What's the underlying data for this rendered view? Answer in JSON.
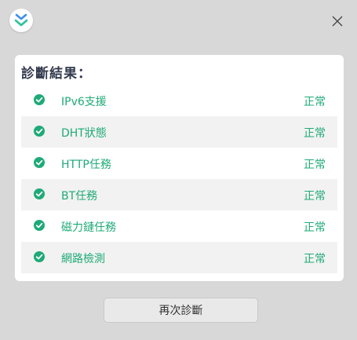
{
  "window": {
    "logo_icon": "app-logo-icon",
    "close_icon": "close-icon"
  },
  "panel": {
    "title": "診斷結果：",
    "items": [
      {
        "label": "IPv6支援",
        "status": "正常"
      },
      {
        "label": "DHT狀態",
        "status": "正常"
      },
      {
        "label": "HTTP任務",
        "status": "正常"
      },
      {
        "label": "BT任務",
        "status": "正常"
      },
      {
        "label": "磁力鏈任務",
        "status": "正常"
      },
      {
        "label": "網路檢測",
        "status": "正常"
      }
    ]
  },
  "footer": {
    "rediagnose_label": "再次診斷"
  },
  "colors": {
    "accent": "#1eaa78",
    "logo_blue": "#3c8ef0",
    "logo_teal": "#28c39b"
  }
}
